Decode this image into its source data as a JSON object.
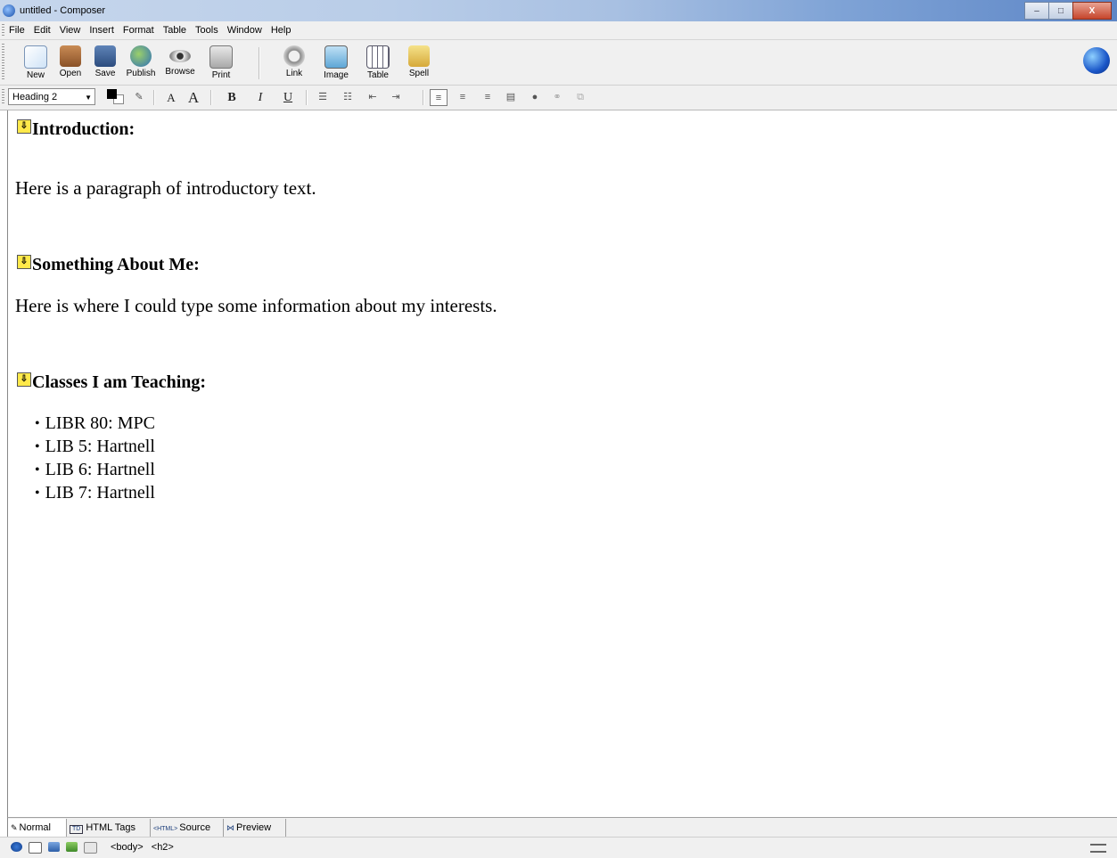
{
  "window": {
    "title": "untitled - Composer",
    "controls": {
      "minimize": "–",
      "maximize": "□",
      "close": "X"
    }
  },
  "menu": [
    {
      "label": "File"
    },
    {
      "label": "Edit"
    },
    {
      "label": "View"
    },
    {
      "label": "Insert"
    },
    {
      "label": "Format"
    },
    {
      "label": "Table"
    },
    {
      "label": "Tools"
    },
    {
      "label": "Window"
    },
    {
      "label": "Help"
    }
  ],
  "toolbar": {
    "new": "New",
    "open": "Open",
    "save": "Save",
    "publish": "Publish",
    "browse": "Browse",
    "print": "Print",
    "link": "Link",
    "image": "Image",
    "table": "Table",
    "spell": "Spell"
  },
  "format_toolbar": {
    "paragraph_style": "Heading 2",
    "smaller_font": "A",
    "larger_font": "A",
    "bold": "B",
    "italic": "I",
    "underline": "U"
  },
  "document": {
    "heading1": "Introduction:",
    "para1": "Here is a paragraph of introductory text.",
    "heading2": "Something About Me:",
    "para2": "Here is where I could type some information about my interests.",
    "heading3": "Classes I am Teaching:",
    "classes": [
      "LIBR 80: MPC",
      "LIB 5: Hartnell",
      "LIB 6: Hartnell",
      "LIB 7: Hartnell"
    ]
  },
  "edit_tabs": {
    "normal": "Normal",
    "html_tags": "HTML Tags",
    "html_tags_badge": "TD",
    "source": "Source",
    "source_badge": "<HTML>",
    "preview": "Preview"
  },
  "status": {
    "tags": [
      "<body>",
      "<h2>"
    ]
  },
  "colors": {
    "titlebar_start": "#c6d6ec",
    "titlebar_end": "#5d86c6",
    "anchor_yellow": "#ffe94a"
  }
}
